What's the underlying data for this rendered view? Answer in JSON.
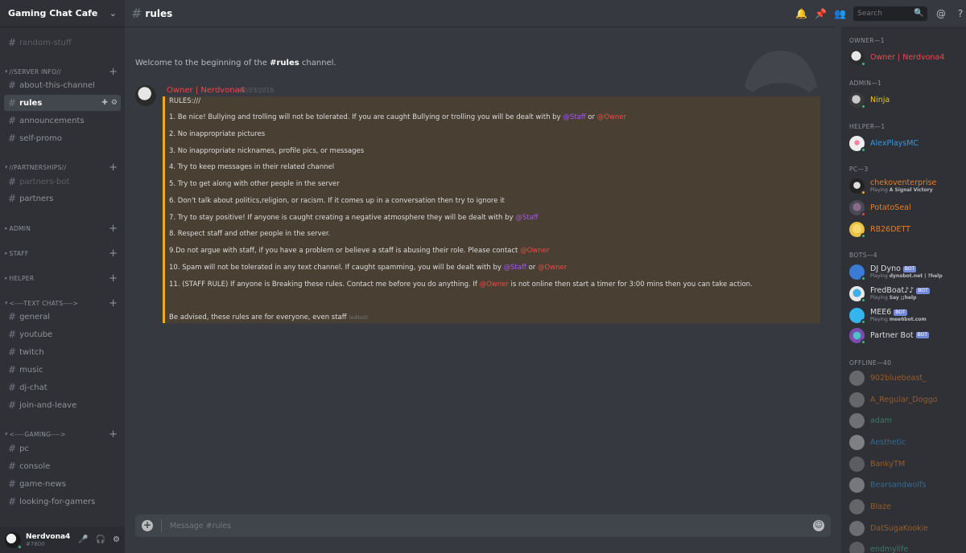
{
  "server": {
    "name": "Gaming Chat Cafe"
  },
  "channels": {
    "random_stuff": "random-stuff",
    "cat_server_info": "//SERVER INFO//",
    "about": "about-this-channel",
    "rules": "rules",
    "announcements": "announcements",
    "self_promo": "self-promo",
    "cat_partnerships": "//PARTNERSHIPS//",
    "partners_bot": "partners-bot",
    "partners": "partners",
    "cat_admin": "ADMIN",
    "cat_staff": "STAFF",
    "cat_helper": "HELPER",
    "cat_text": "<----TEXT CHATS---->",
    "general": "general",
    "youtube": "youtube",
    "twitch": "twitch",
    "music": "music",
    "dj_chat": "dj-chat",
    "join_leave": "join-and-leave",
    "cat_gaming": "<----GAMING---->",
    "pc": "pc",
    "console": "console",
    "game_news": "game-news",
    "looking": "looking-for-gamers"
  },
  "user": {
    "name": "Nerdvona4",
    "tag": "#7800"
  },
  "header": {
    "channel": "rules",
    "search_placeholder": "Search"
  },
  "welcome": {
    "prefix": "Welcome to the beginning of the ",
    "channel": "#rules",
    "suffix": " channel."
  },
  "message": {
    "author": "Owner | Nerdvona4",
    "timestamp": "02/03/2018",
    "heading": "RULES:///",
    "r1": "1. Be nice! Bullying and trolling will not be tolerated. If you are caught Bullying or trolling you will be dealt with by ",
    "r2": "2. No inappropriate pictures",
    "r3": "3. No inappropriate nicknames, profile pics, or messages",
    "r4": "4. Try to keep messages in their related channel",
    "r5": "5. Try to get along with other people in the server",
    "r6": "6. Don't talk about politics,religion, or racism. If it comes up in a conversation then try to ignore it",
    "r7": "7. Try to stay positive! If anyone is caught creating a negative atmosphere they will be dealt with by ",
    "r8": "8. Respect staff and other people in the server.",
    "r9": "9.Do not argue with staff, if you have a problem or believe a staff is abusing their role. Please contact ",
    "r10": "10. Spam will not be tolerated in any text channel. If caught spamming, you will be dealt with by ",
    "r11a": "11. (STAFF RULE) If anyone is Breaking these rules. Contact me before you do anything. If ",
    "r11b": " is not online then start a timer for 3:00 mins then you can take action.",
    "footer": "Be advised, these rules are for everyone, even staff",
    "edited": "(edited)",
    "mention_staff": "@Staff",
    "mention_owner": "@Owner",
    "or": " or "
  },
  "composer": {
    "placeholder": "Message #rules"
  },
  "members": {
    "groups": {
      "owner": "OWNER—1",
      "admin": "ADMIN—1",
      "helper": "HELPER—1",
      "pc": "PC—3",
      "bots": "BOTS—4",
      "offline": "OFFLINE—40"
    },
    "list": {
      "owner": "Owner | Nerdvona4",
      "ninja": "Ninja",
      "alex": "AlexPlaysMC",
      "cheko": "chekoventerprise",
      "cheko_status": "A Signal Victory",
      "potato": "PotatoSeal",
      "rb": "RB26DETT",
      "dyno": "DJ Dyno",
      "dyno_status": "dynobot.net | ?help",
      "fred": "FredBoat♪♪",
      "fred_status": "Say ;;help",
      "mee6": "MEE6",
      "mee6_status": "mee6bot.com",
      "partner": "Partner Bot",
      "o1": "902bluebeast_",
      "o2": "A_Regular_Doggo",
      "o3": "adam",
      "o4": "Aesthetic",
      "o5": "BankyTM",
      "o6": "Bearsandwolfs",
      "o7": "Blaze",
      "o8": "DatSugaKookie",
      "o9": "endmylife"
    },
    "playing_label": "Playing",
    "bot_label": "BOT"
  },
  "colors": {
    "owner": "#f04747",
    "admin": "#f1c40f",
    "helper": "#3498db",
    "pc": "#e67e22",
    "online": "#43b581",
    "idle": "#faa61a",
    "dnd": "#f04747",
    "staff_mention": "#a855f7"
  }
}
